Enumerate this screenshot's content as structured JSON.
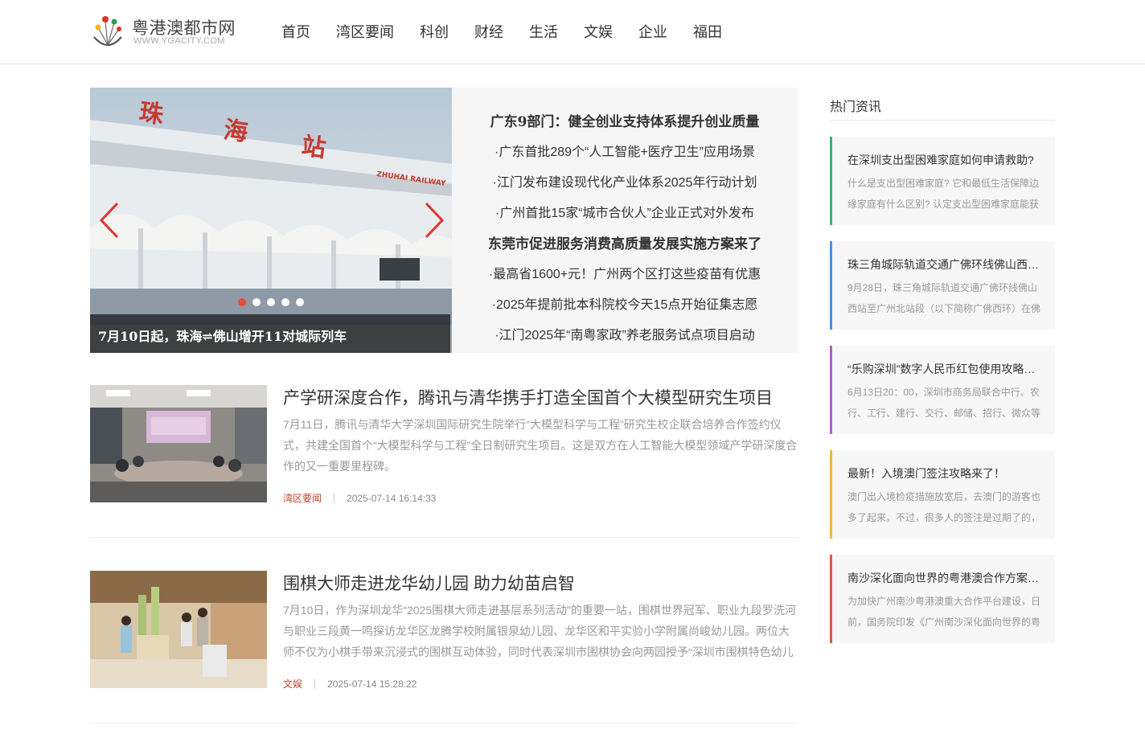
{
  "site": {
    "name": "粤港澳都市网",
    "url_text": "WWW.YGACITY.COM"
  },
  "nav": [
    {
      "label": "首页"
    },
    {
      "label": "湾区要闻"
    },
    {
      "label": "科创"
    },
    {
      "label": "财经"
    },
    {
      "label": "生活"
    },
    {
      "label": "文娱"
    },
    {
      "label": "企业"
    },
    {
      "label": "福田"
    }
  ],
  "featured": {
    "slide_caption": "7月10日起，珠海⇌佛山增开11对城际列车",
    "slide_sign_text": "珠 海 站",
    "slide_sub_sign": "ZHUHAI RAILWAY",
    "dots_count": 5,
    "active_dot": 0,
    "headlines": [
      {
        "text": "广东9部门：健全创业支持体系提升创业质量",
        "bold": true
      },
      {
        "text": "·广东首批289个“人工智能+医疗卫生”应用场景",
        "bold": false
      },
      {
        "text": "·江门发布建设现代化产业体系2025年行动计划",
        "bold": false
      },
      {
        "text": "·广州首批15家“城市合伙人”企业正式对外发布",
        "bold": false
      },
      {
        "text": "东莞市促进服务消费高质量发展实施方案来了",
        "bold": true
      },
      {
        "text": "·最高省1600+元！广州两个区打这些疫苗有优惠",
        "bold": false
      },
      {
        "text": "·2025年提前批本科院校今天15点开始征集志愿",
        "bold": false
      },
      {
        "text": "·江门2025年“南粤家政”养老服务试点项目启动",
        "bold": false
      }
    ]
  },
  "articles": [
    {
      "title": "产学研深度合作，腾讯与清华携手打造全国首个大模型研究生项目",
      "summary": "7月11日，腾讯与清华大学深圳国际研究生院举行“大模型科学与工程”研究生校企联合培养合作签约仪式，共建全国首个“大模型科学与工程”全日制研究生项目。这是双方在人工智能大模型领域产学研深度合作的又一重要里程碑。",
      "category": "湾区要闻",
      "time": "2025-07-14 16:14:33"
    },
    {
      "title": "围棋大师走进龙华幼儿园 助力幼苗启智",
      "summary": "7月10日，作为深圳龙华“2025围棋大师走进基层系列活动”的重要一站，围棋世界冠军、职业九段罗洗河与职业三段黄一鸣探访龙华区龙腾学校附属银泉幼儿园、龙华区和平实验小学附属尚峻幼儿园。两位大师不仅为小棋手带来沉浸式的围棋互动体验，同时代表深圳市围棋协会向两园授予“深圳市围棋特色幼儿",
      "category": "文娱",
      "time": "2025-07-14 15:28:22"
    }
  ],
  "sidebar": {
    "title": "热门资讯",
    "cards": [
      {
        "title": "在深圳支出型困难家庭如何申请救助?",
        "text": "什么是支出型困难家庭? 它和最低生活保障边缘家庭有什么区别? 认定支出型困难家庭能获",
        "accent": "#3cb56b"
      },
      {
        "title": "珠三角城际轨道交通广佛环线佛山西站至广州北站段",
        "text": "9月28日，珠三角城际轨道交通广佛环线佛山西站至广州北站段（以下简称广佛西环）在佛",
        "accent": "#4a8fe0"
      },
      {
        "title": "“乐购深圳”数字人民币红包使用攻略来了",
        "text": "6月13日20：00，深圳市商务局联合中行、农行、工行、建行、交行、邮储、招行、微众等",
        "accent": "#b35ec8"
      },
      {
        "title": "最新！入境澳门签注攻略来了！",
        "text": "澳门出入境检疫措施放宽后，去澳门的游客也多了起来。不过，很多人的签注是过期了的，",
        "accent": "#f0b63a"
      },
      {
        "title": "南沙深化面向世界的粤港澳合作方案出台",
        "text": "为加快广州南沙粤港澳重大合作平台建设，日前，国务院印发《广州南沙深化面向世界的粤",
        "accent": "#e05a45"
      }
    ]
  },
  "colors": {
    "accent_red": "#c0462f",
    "active_dot": "#e84a3c"
  }
}
